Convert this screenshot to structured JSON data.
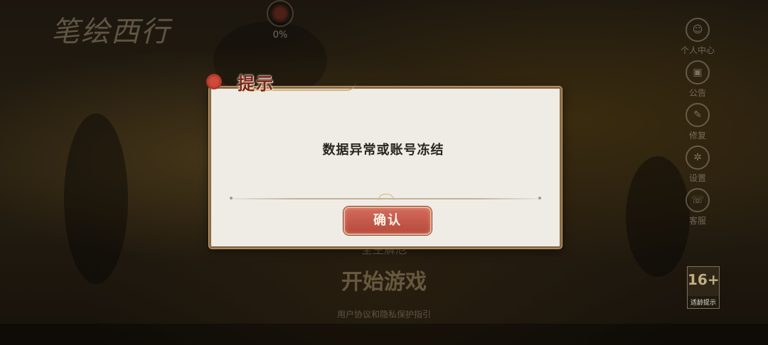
{
  "background": {
    "logo_text": "笔绘西行",
    "loading_percent": "0%",
    "side_menu": [
      {
        "icon": "person-icon",
        "glyph": "☺",
        "label": "个人中心"
      },
      {
        "icon": "notice-icon",
        "glyph": "▣",
        "label": "公告"
      },
      {
        "icon": "repair-icon",
        "glyph": "✎",
        "label": "修复"
      },
      {
        "icon": "settings-icon",
        "glyph": "✲",
        "label": "设置"
      },
      {
        "icon": "service-icon",
        "glyph": "☏",
        "label": "客服"
      }
    ],
    "server_name": "全生解厄",
    "start_button": "开始游戏",
    "agreement_text": "用户协议和隐私保护指引",
    "age_rating": "16+",
    "age_label": "适龄提示"
  },
  "dialog": {
    "title": "提示",
    "message": "数据异常或账号冻结",
    "confirm_label": "确认"
  }
}
